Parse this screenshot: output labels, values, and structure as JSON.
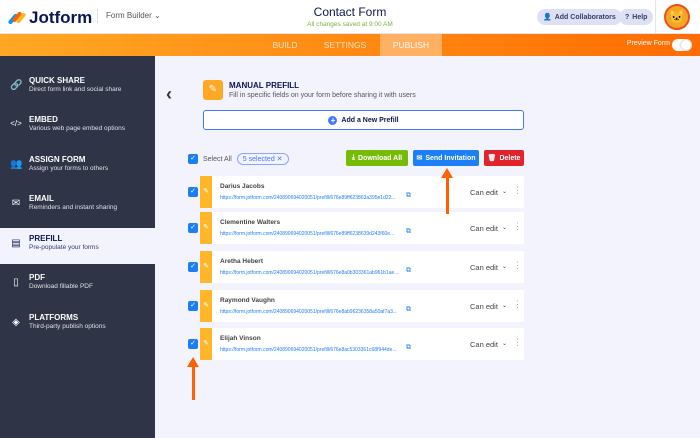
{
  "header": {
    "brand": "Jotform",
    "builder_label": "Form Builder",
    "form_title": "Contact Form",
    "save_status": "All changes saved at 9:00 AM",
    "add_collaborators": "Add Collaborators",
    "help": "Help"
  },
  "tabs": [
    {
      "label": "BUILD"
    },
    {
      "label": "SETTINGS"
    },
    {
      "label": "PUBLISH",
      "active": true
    }
  ],
  "preview_label": "Preview Form",
  "sidebar": {
    "items": [
      {
        "title": "QUICK SHARE",
        "desc": "Direct form link and social share",
        "icon": "link-icon"
      },
      {
        "title": "EMBED",
        "desc": "Various web page embed options",
        "icon": "code-icon"
      },
      {
        "title": "ASSIGN FORM",
        "desc": "Assign your forms to others",
        "icon": "users-icon"
      },
      {
        "title": "EMAIL",
        "desc": "Reminders and instant sharing",
        "icon": "envelope-icon"
      },
      {
        "title": "PREFILL",
        "desc": "Pre-populate your forms",
        "icon": "prefill-icon",
        "active": true
      },
      {
        "title": "PDF",
        "desc": "Download fillable PDF",
        "icon": "pdf-icon"
      },
      {
        "title": "PLATFORMS",
        "desc": "Third-party publish options",
        "icon": "layers-icon"
      }
    ]
  },
  "main": {
    "title": "MANUAL PREFILL",
    "subtitle": "Fill in specific fields on your form before sharing it with users",
    "add_button": "Add a New Prefill",
    "select_all": "Select All",
    "selected_count": "5 selected",
    "download_all": "Download All",
    "send_invitation": "Send Invitation",
    "delete": "Delete",
    "rows": [
      {
        "name": "Darius Jacobs",
        "url": "https://form.jotform.com/240890694020051/prefill/676e89ff623863a395e1d22...",
        "permission": "Can edit"
      },
      {
        "name": "Clementine Walters",
        "url": "https://form.jotform.com/240890694020051/prefill/676e89ff6238639d243f60e...",
        "permission": "Can edit"
      },
      {
        "name": "Aretha Hebert",
        "url": "https://form.jotform.com/240890694020051/prefill/676e8a0b303361ab961b1ae...",
        "permission": "Can edit"
      },
      {
        "name": "Raymond Vaughn",
        "url": "https://form.jotform.com/240890694020051/prefill/676e8ab96236358a50af7a3...",
        "permission": "Can edit"
      },
      {
        "name": "Elijah Vinson",
        "url": "https://form.jotform.com/240890694020051/prefill/676e8ac5303361c68f944de...",
        "permission": "Can edit"
      }
    ]
  },
  "colors": {
    "orange": "#ff6100",
    "green": "#78bb07",
    "blue": "#1c7ff5",
    "red": "#e3232c",
    "sidebar": "#2f3447"
  }
}
